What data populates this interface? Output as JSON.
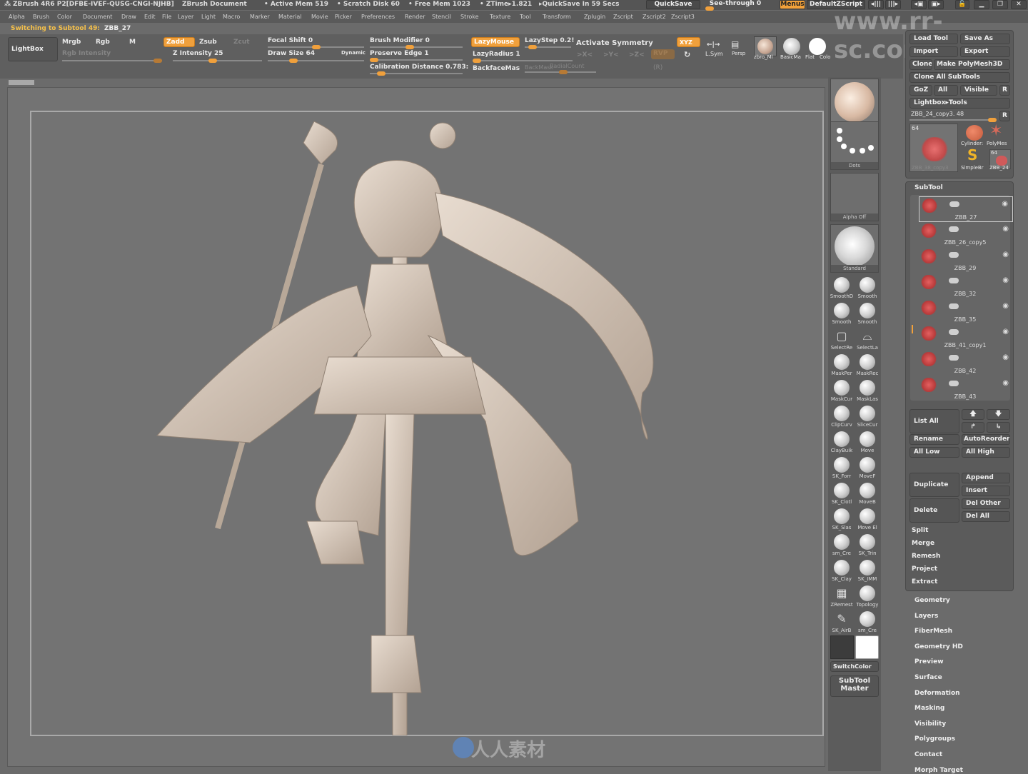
{
  "titlebar": {
    "app": "ZBrush 4R6 P2[DFBE-IVEF-QUSG-CNGI-NJHB]",
    "document": "ZBrush Document",
    "active_mem": "• Active Mem 519",
    "scratch_disk": "• Scratch Disk 60",
    "free_mem": "• Free Mem 1023",
    "ztime": "• ZTime▸1.821",
    "quicksave_info": "▸QuickSave In 59 Secs",
    "quicksave_btn": "QuickSave",
    "see_through": "See-through  0",
    "see_through_value": 0,
    "menus_btn": "Menus",
    "script_btn": "DefaultZScript"
  },
  "menubar": [
    "Alpha",
    "Brush",
    "Color",
    "Document",
    "Draw",
    "Edit",
    "File",
    "Layer",
    "Light",
    "Macro",
    "Marker",
    "Material",
    "Movie",
    "Picker",
    "Preferences",
    "Render",
    "Stencil",
    "Stroke",
    "Texture",
    "Tool",
    "Transform",
    "Zplugin",
    "Zscript",
    "Zscript2",
    "Zscript3"
  ],
  "status": {
    "label": "Switching to Subtool 49:",
    "value": "ZBB_27"
  },
  "shelf": {
    "lightbox": "LightBox",
    "mrgb": "Mrgb",
    "rgb": "Rgb",
    "m": "M",
    "zadd": "Zadd",
    "zsub": "Zsub",
    "zcut": "Zcut",
    "rgb_intensity": "Rgb Intensity",
    "z_intensity": "Z Intensity 25",
    "focal_shift": "Focal Shift 0",
    "draw_size": "Draw Size 64",
    "dynamic": "Dynamic",
    "brush_modifier": "Brush Modifier 0",
    "preserve_edge": "Preserve Edge 1",
    "calibration": "Calibration Distance 0.783:",
    "lazymouse": "LazyMouse",
    "lazystep": "LazyStep 0.2!",
    "lazyradius": "LazyRadius 1",
    "backfacemas": "BackfaceMas",
    "backmask_dim": "BackMask",
    "radialcount": "RadialCount",
    "activate_symmetry": "Activate Symmetry",
    "sym_x": ">X<",
    "sym_y": ">Y<",
    "sym_z": ">Z<",
    "xyz": "XYZ",
    "rvp": "RVP",
    "r": "(R)",
    "lsym": "L.Sym",
    "persp": "Persp",
    "mat1": "zbro_Ml",
    "mat2": "BasicMa",
    "mat3": "Flat",
    "mat4": "Colo"
  },
  "brush_palette": {
    "thumbs": [
      "",
      "Dots",
      "Alpha Off",
      "Standard"
    ],
    "brushes": [
      [
        "SmoothD",
        "Smooth"
      ],
      [
        "Smooth",
        "Smooth"
      ],
      [
        "SelectRe",
        "SelectLa"
      ],
      [
        "MaskPer",
        "MaskRec"
      ],
      [
        "MaskCur",
        "MaskLas"
      ],
      [
        "ClipCurv",
        "SliceCur"
      ],
      [
        "ClayBuik",
        "Move"
      ],
      [
        "SK_Forr",
        "MoveF"
      ],
      [
        "SK_Clotl",
        "MoveB"
      ],
      [
        "SK_Slas",
        "Move El"
      ],
      [
        "sm_Cre",
        "SK_Trin"
      ],
      [
        "SK_Clay",
        "SK_IMM"
      ],
      [
        "ZRemest",
        "Topology"
      ],
      [
        "SK_AirB",
        "sm_Cre"
      ]
    ],
    "switch_color": "SwitchColor",
    "subtool_master": "SubTool Master"
  },
  "tool_panel": {
    "load_tool": "Load Tool",
    "save_as": "Save As",
    "import": "Import",
    "export": "Export",
    "clone": "Clone",
    "make_polymesh": "Make PolyMesh3D",
    "clone_all": "Clone All SubTools",
    "goz": "GoZ",
    "all": "All",
    "visible": "Visible",
    "r": "R",
    "lightbox_tools": "Lightbox▸Tools",
    "current_tool": "ZBB_24_copy3. 48",
    "thumb_count": "64",
    "thumb_name": "ZBB_38_copy3",
    "cylinder": "Cylinder:",
    "polymesh": "PolyMes",
    "simplebr": "SimpleBr",
    "zbb24": "ZBB_24",
    "zbb24_count": "64"
  },
  "subtool": {
    "title": "SubTool",
    "items": [
      "ZBB_27",
      "ZBB_26_copy5",
      "ZBB_29",
      "ZBB_32",
      "ZBB_35",
      "ZBB_41_copy1",
      "ZBB_42",
      "ZBB_43"
    ],
    "list_all": "List All",
    "rename": "Rename",
    "autoreorder": "AutoReorder",
    "all_low": "All Low",
    "all_high": "All High",
    "duplicate": "Duplicate",
    "append": "Append",
    "insert": "Insert",
    "delete": "Delete",
    "del_other": "Del Other",
    "del_all": "Del All",
    "split": "Split",
    "merge": "Merge",
    "remesh": "Remesh",
    "project": "Project",
    "extract": "Extract"
  },
  "tool_sections": [
    "Geometry",
    "Layers",
    "FiberMesh",
    "Geometry HD",
    "Preview",
    "Surface",
    "Deformation",
    "Masking",
    "Visibility",
    "Polygroups",
    "Contact",
    "Morph Target"
  ],
  "watermarks": {
    "url": "www.rr-sc.com",
    "brand": "人人素材"
  }
}
